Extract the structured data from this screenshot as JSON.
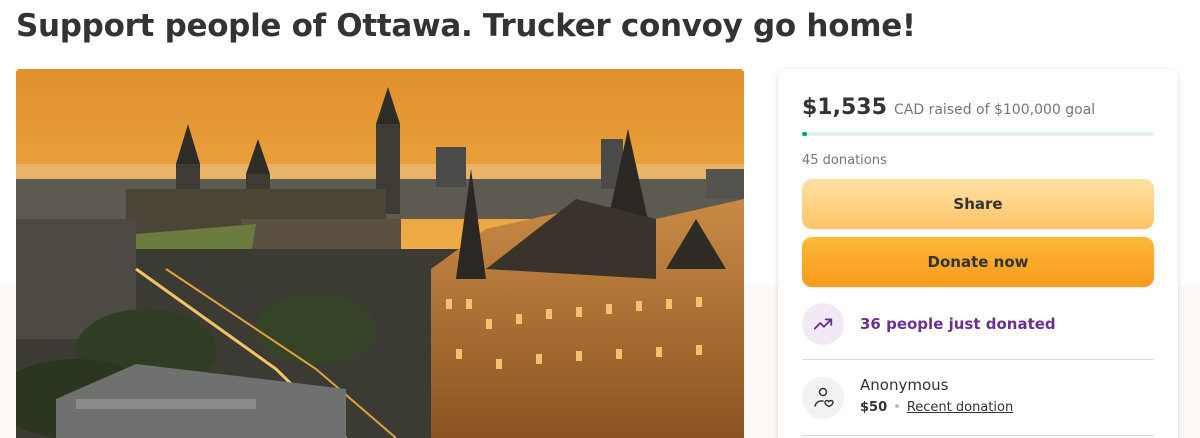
{
  "page": {
    "title": "Support people of Ottawa. Trucker convoy go home!"
  },
  "campaign": {
    "amount_raised": "$1,535",
    "goal_text": "CAD raised of $100,000 goal",
    "progress_fraction": 0.015,
    "donations_count": "45 donations",
    "share_label": "Share",
    "donate_label": "Donate now",
    "trending_text": "36 people just donated"
  },
  "recent_donation": {
    "name": "Anonymous",
    "amount": "$50",
    "separator": "•",
    "link_text": "Recent donation"
  },
  "colors": {
    "progress": "#02a95c",
    "share_button": "#fdc468",
    "donate_button": "#f89a1d",
    "trending_text": "#6b2f8f"
  },
  "icons": {
    "trending": "trending-up-icon",
    "donor": "hand-heart-icon"
  }
}
